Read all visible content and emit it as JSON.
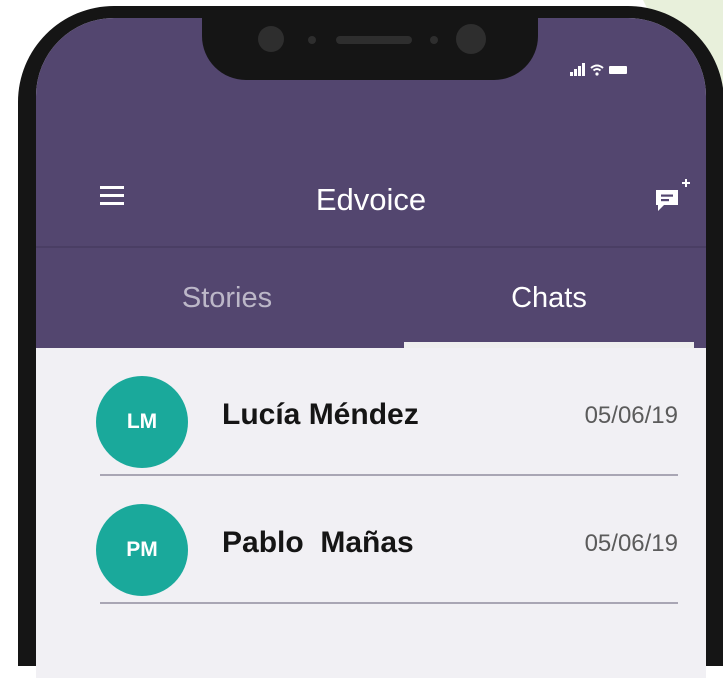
{
  "app": {
    "title": "Edvoice"
  },
  "colors": {
    "appbar": "#53466f",
    "avatar": "#1aa99b",
    "list_background": "#f1f0f4",
    "phone_frame": "#151515"
  },
  "icons": {
    "menu": "hamburger-menu-icon",
    "new_chat": "new-chat-icon",
    "signal": "signal-icon",
    "wifi": "wifi-icon",
    "battery": "battery-icon"
  },
  "tabs": [
    {
      "label": "Stories",
      "active": false
    },
    {
      "label": "Chats",
      "active": true
    }
  ],
  "chats": [
    {
      "initials": "LM",
      "name": "Lucía Méndez",
      "date": "05/06/19"
    },
    {
      "initials": "PM",
      "name": "Pablo  Mañas",
      "date": "05/06/19"
    }
  ]
}
